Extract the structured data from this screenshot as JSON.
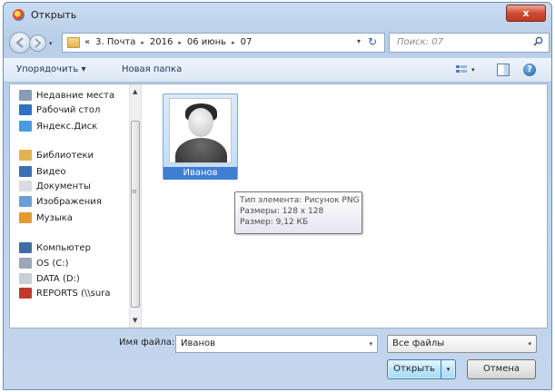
{
  "window": {
    "title": "Открыть",
    "close_label": "x"
  },
  "address": {
    "prefix": "«",
    "crumbs": [
      "3. Почта",
      "2016",
      "06 июнь",
      "07"
    ],
    "separator": "▸",
    "dropdown": "▾",
    "refresh_glyph": "↻"
  },
  "search": {
    "placeholder": "Поиск: 07"
  },
  "toolbar": {
    "organize_label": "Упорядочить ▾",
    "new_folder_label": "Новая папка",
    "view_dropdown": "▾",
    "help_glyph": "?"
  },
  "nav_pane": {
    "items": [
      {
        "label": "Недавние места",
        "icon": "recent-places-icon",
        "color": "#8a9bb5"
      },
      {
        "label": "Рабочий стол",
        "icon": "desktop-icon",
        "color": "#2f6fc4"
      },
      {
        "label": "Яндекс.Диск",
        "icon": "cloud-icon",
        "color": "#4b9be0"
      },
      {
        "label": "Библиотеки",
        "icon": "libraries-icon",
        "color": "#e1b44e"
      },
      {
        "label": "Видео",
        "icon": "video-icon",
        "color": "#3a6fb5"
      },
      {
        "label": "Документы",
        "icon": "documents-icon",
        "color": "#d9dde3"
      },
      {
        "label": "Изображения",
        "icon": "pictures-icon",
        "color": "#6a9ed8"
      },
      {
        "label": "Музыка",
        "icon": "music-icon",
        "color": "#e39b2d"
      },
      {
        "label": "Компьютер",
        "icon": "computer-icon",
        "color": "#3e6ea8"
      },
      {
        "label": "OS (C:)",
        "icon": "drive-c-icon",
        "color": "#9aa8b7"
      },
      {
        "label": "DATA (D:)",
        "icon": "drive-d-icon",
        "color": "#c9cfd6"
      },
      {
        "label": "REPORTS (\\\\sura",
        "icon": "network-drive-icon",
        "color": "#c0392b"
      }
    ],
    "scroll_up": "▲",
    "scroll_down": "▼",
    "scroll_grip": "≡"
  },
  "files": [
    {
      "name": "Иванов"
    }
  ],
  "tooltip": {
    "lines": [
      "Тип элемента: Рисунок PNG",
      "Размеры: 128 x 128",
      "Размер: 9,12 КБ"
    ]
  },
  "bottom": {
    "filename_label": "Имя файла:",
    "filename_value": "Иванов",
    "filename_dropdown": "▾",
    "filetype_value": "Все файлы",
    "filetype_dropdown": "▾",
    "open_label": "Открыть",
    "open_split": "▾",
    "cancel_label": "Отмена"
  }
}
